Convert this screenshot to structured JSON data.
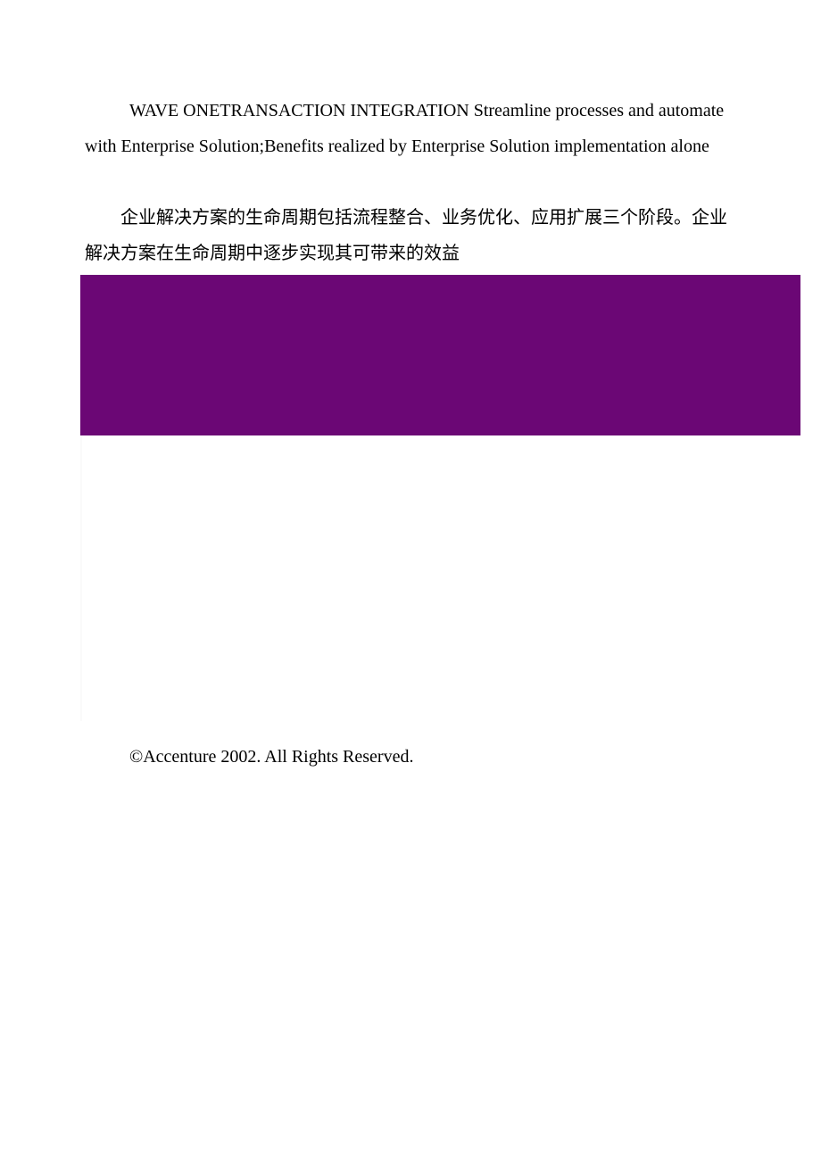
{
  "paragraphs": {
    "english": "WAVE ONETRANSACTION INTEGRATION Streamline processes and automate with Enterprise Solution;Benefits realized by Enterprise Solution implementation alone",
    "chinese": "企业解决方案的生命周期包括流程整合、业务优化、应用扩展三个阶段。企业解决方案在生命周期中逐步实现其可带来的效益"
  },
  "footer": {
    "copyright": "©Accenture 2002. All Rights Reserved."
  },
  "colors": {
    "band": "#6b0775"
  }
}
